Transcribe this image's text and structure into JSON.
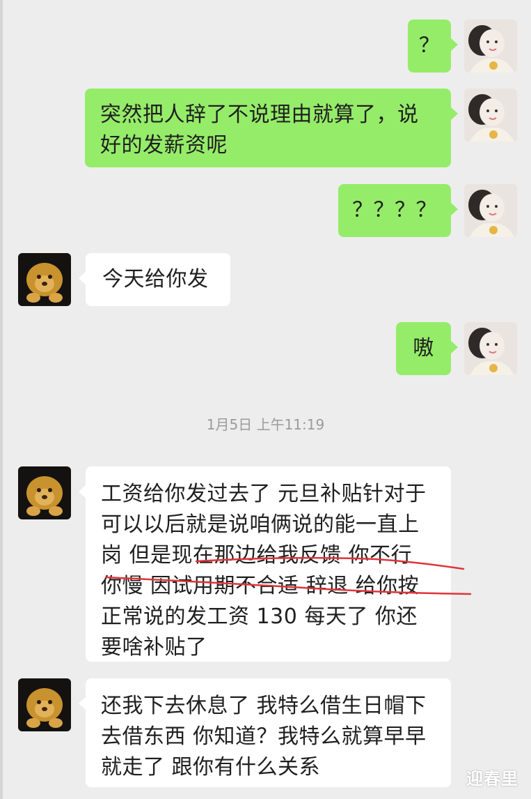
{
  "chat": {
    "messages": [
      {
        "side": "out",
        "text": "？"
      },
      {
        "side": "out",
        "text": "突然把人辞了不说理由就算了，说好的发薪资呢"
      },
      {
        "side": "out",
        "text": "？？？？"
      },
      {
        "side": "in",
        "text": "今天给你发"
      },
      {
        "side": "out",
        "text": "嗷"
      },
      {
        "side": "in",
        "text": "工资给你发过去了 元旦补贴针对于可以以后就是说咱俩说的能一直上岗 但是现在那边给我反馈 你不行 你慢 因试用期不合适 辞退 给你按正常说的发工资 130 每天了 你还要啥补贴了"
      },
      {
        "side": "in",
        "text": "还我下去休息了 我特么借生日帽下去借东西 你知道？我特么就算早早就走了 跟你有什么关系"
      }
    ],
    "timestamp": "1月5日 上午11:19"
  },
  "colors": {
    "background": "#ededed",
    "outgoing_bubble": "#95ec69",
    "incoming_bubble": "#ffffff",
    "annotation_red": "#e0343a"
  },
  "icons": {
    "self_avatar": "baby-photo-avatar",
    "contact_avatar": "lion-cub-avatar"
  },
  "watermark": "迎春里"
}
